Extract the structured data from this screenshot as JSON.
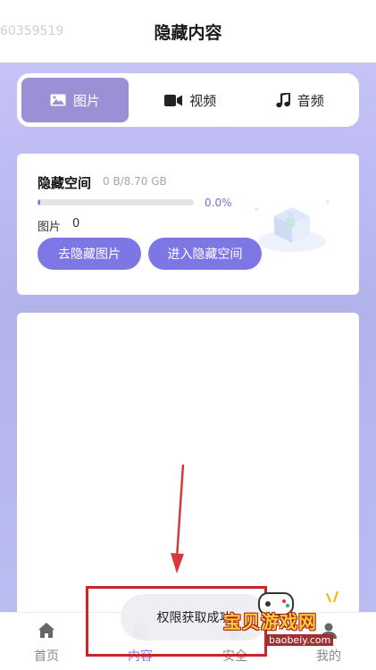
{
  "status": {
    "device_id": "60359519"
  },
  "header": {
    "title": "隐藏内容"
  },
  "tabs": [
    {
      "label": "图片",
      "icon": "image-icon",
      "active": true
    },
    {
      "label": "视频",
      "icon": "video-icon",
      "active": false
    },
    {
      "label": "音频",
      "icon": "music-icon",
      "active": false
    }
  ],
  "space": {
    "title": "隐藏空间",
    "size": "0 B/8.70 GB",
    "progress_percent": 0.0,
    "progress_text": "0.0%",
    "count_label": "图片",
    "count_value": "0",
    "hide_button": "去隐藏图片",
    "enter_button": "进入隐藏空间"
  },
  "toast": {
    "text": "权限获取成功"
  },
  "nav": [
    {
      "label": "首页",
      "icon": "home-icon"
    },
    {
      "label": "内容",
      "icon": "content-icon",
      "active": true
    },
    {
      "label": "安全",
      "icon": "shield-icon"
    },
    {
      "label": "我的",
      "icon": "user-icon"
    }
  ],
  "watermark": {
    "name": "宝贝游戏网",
    "url": "baobeiy.com"
  },
  "colors": {
    "accent": "#7e78e6",
    "tab_active": "#9b90d6",
    "annotation": "#c8262c"
  }
}
